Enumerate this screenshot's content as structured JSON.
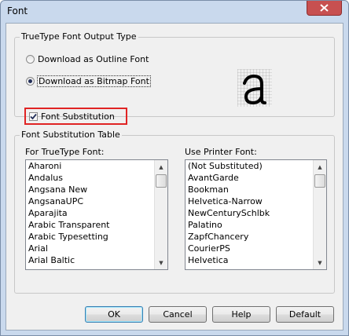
{
  "window": {
    "title": "Font"
  },
  "output_group": {
    "label": "TrueType Font Output Type",
    "options": [
      {
        "label": "Download as Outline Font",
        "checked": false
      },
      {
        "label": "Download as Bitmap Font",
        "checked": true
      }
    ]
  },
  "substitution_checkbox": {
    "label": "Font Substitution",
    "checked": true
  },
  "table_group": {
    "label": "Font Substitution Table",
    "truetype_list": {
      "label": "For TrueType Font:",
      "items": [
        "Aharoni",
        "Andalus",
        "Angsana New",
        "AngsanaUPC",
        "Aparajita",
        "Arabic Transparent",
        "Arabic Typesetting",
        "Arial",
        "Arial Baltic"
      ]
    },
    "printer_list": {
      "label": "Use Printer Font:",
      "items": [
        "(Not Substituted)",
        "AvantGarde",
        "Bookman",
        "Helvetica-Narrow",
        "NewCenturySchlbk",
        "Palatino",
        "ZapfChancery",
        "CourierPS",
        "Helvetica"
      ]
    }
  },
  "buttons": {
    "ok": "OK",
    "cancel": "Cancel",
    "help": "Help",
    "default": "Default"
  },
  "icons": {
    "close": "close-icon",
    "preview": "bitmap-font-preview-icon",
    "check": "checkmark-icon"
  }
}
